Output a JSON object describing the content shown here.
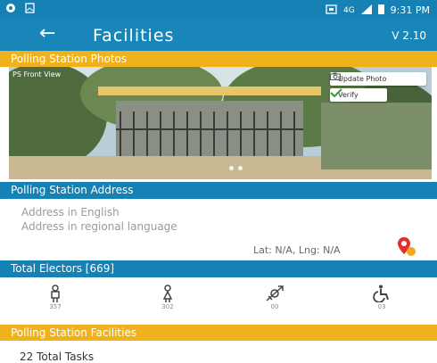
{
  "status_bar": {
    "network": "4G",
    "time": "9:31 PM"
  },
  "toolbar": {
    "title": "Facilities",
    "version": "V 2.10"
  },
  "photos_section": {
    "title": "Polling Station Photos",
    "photo_label": "PS Front View",
    "update_label": "Update Photo",
    "verify_label": "Verify"
  },
  "address_section": {
    "title": "Polling Station Address",
    "address_english": "Address in English",
    "address_regional": "Address in regional language",
    "latlng": "Lat: N/A, Lng: N/A"
  },
  "electors": {
    "title": "Total Electors [669]",
    "items": [
      {
        "icon": "male-icon",
        "count": "357"
      },
      {
        "icon": "female-icon",
        "count": "302"
      },
      {
        "icon": "third-gender-icon",
        "count": "00"
      },
      {
        "icon": "disabled-icon",
        "count": "03"
      }
    ]
  },
  "facilities": {
    "title": "Polling Station Facilities",
    "total_tasks": "22 Total Tasks"
  },
  "colors": {
    "primary": "#1681b4",
    "accent": "#f0b21c"
  }
}
